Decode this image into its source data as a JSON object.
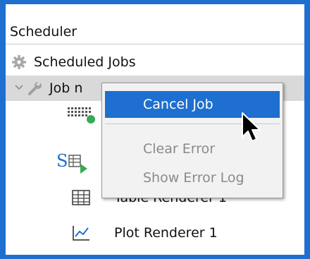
{
  "panel": {
    "title": "Scheduler"
  },
  "tree": {
    "root": {
      "label": "Scheduled Jobs",
      "icon": "gear-icon"
    },
    "job": {
      "label": "Job n",
      "icon": "wrench-icon"
    },
    "children": [
      {
        "label": "",
        "icon": "data-grid-icon"
      },
      {
        "label": "",
        "icon": "script-table-icon"
      },
      {
        "label": "Table Renderer 1",
        "icon": "table-icon"
      },
      {
        "label": "Plot Renderer 1",
        "icon": "line-chart-icon"
      }
    ]
  },
  "context_menu": {
    "items": [
      {
        "label": "Cancel Job",
        "state": "highlighted"
      },
      {
        "label": "Clear Error",
        "state": "disabled"
      },
      {
        "label": "Show Error Log",
        "state": "disabled"
      }
    ]
  },
  "colors": {
    "accent": "#1e6fd0",
    "selection": "#d9d9d9",
    "menu_bg": "#f2f2f2",
    "disabled_text": "#8a8a8a"
  }
}
